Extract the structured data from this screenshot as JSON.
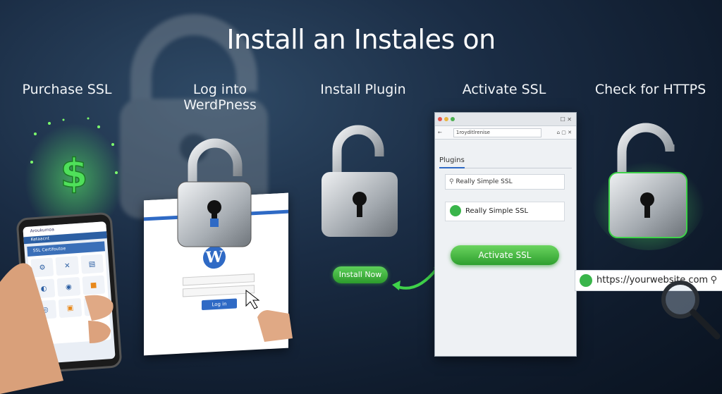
{
  "title": "Install an Instales on",
  "steps": [
    {
      "label": "Purchase SSL"
    },
    {
      "label": "Log into WerdPness"
    },
    {
      "label": "Install Plugin"
    },
    {
      "label": "Activate SSL"
    },
    {
      "label": "Check for HTTPS"
    }
  ],
  "phone": {
    "app_title": "Aroukumoa",
    "nav_label": "Ketaacnt",
    "panel_title": "SSL Certifoutoe",
    "dollar_icon": "dollar-icon"
  },
  "wordpress": {
    "login_button": "Log in",
    "logo_letter": "W"
  },
  "install_now_button": "Install Now",
  "browser": {
    "url": "1royditlrenise",
    "plugins_heading": "Plugins",
    "search_value": "Really Simple SSL",
    "plugin_name": "Really Simple SSL",
    "activate_button": "Activate SSL"
  },
  "https_bar": {
    "url": "https://yourwebsite.com"
  },
  "colors": {
    "accent_green": "#39b54a",
    "accent_blue": "#2f6ac5",
    "background": "#1a2c44"
  }
}
